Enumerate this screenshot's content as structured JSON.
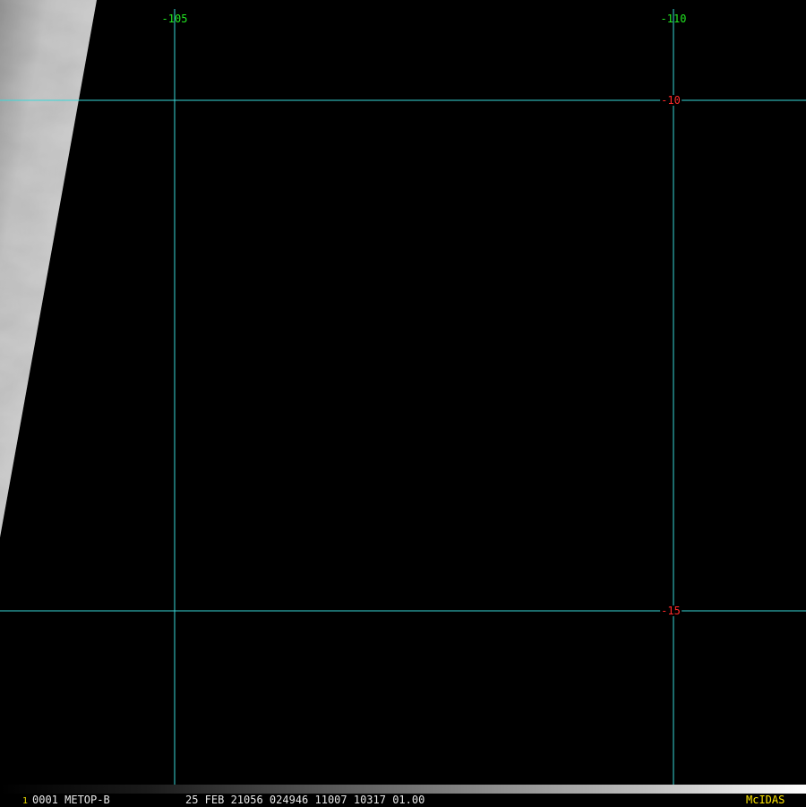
{
  "grid": {
    "line_color": "#39d9d9",
    "longitudes": [
      {
        "label": "-105",
        "value": -105
      },
      {
        "label": "-110",
        "value": -110
      }
    ],
    "latitudes": [
      {
        "label": "-10",
        "value": -10
      },
      {
        "label": "-15",
        "value": -15
      }
    ]
  },
  "status": {
    "frame_number": "1",
    "satellite": "0001 METOP-B",
    "timestamp": "25 FEB 21056 024946 11007 10317 01.00",
    "brand": "McIDAS"
  },
  "colors": {
    "background": "#000000",
    "longitude_label": "#22e622",
    "latitude_label": "#ff2a2a",
    "status_text": "#e8e8e8",
    "brand": "#ffe600"
  }
}
